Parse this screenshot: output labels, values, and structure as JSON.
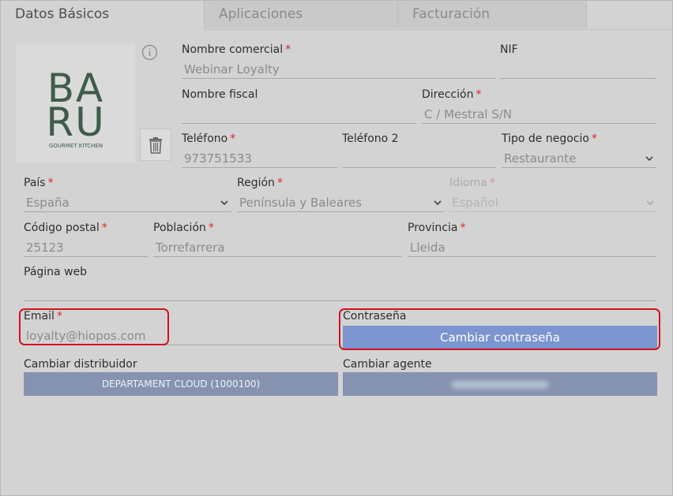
{
  "tabs": [
    {
      "label": "Datos Básicos"
    },
    {
      "label": "Aplicaciones"
    },
    {
      "label": "Facturación"
    }
  ],
  "logo": {
    "letters_top": "BA",
    "letters_bottom": "RU",
    "tagline": "GOURMET KITCHEN"
  },
  "icons": {
    "info": "info-icon",
    "delete": "trash-icon",
    "dropdown": "chevron-down-icon"
  },
  "form": {
    "nombre_comercial": {
      "label": "Nombre comercial",
      "value": "Webinar Loyalty",
      "required": "*"
    },
    "nif": {
      "label": "NIF",
      "value": ""
    },
    "nombre_fiscal": {
      "label": "Nombre fiscal",
      "value": ""
    },
    "direccion": {
      "label": "Dirección",
      "value": "C / Mestral S/N",
      "required": "*"
    },
    "telefono": {
      "label": "Teléfono",
      "value": "973751533",
      "required": "*"
    },
    "telefono2": {
      "label": "Teléfono 2",
      "value": ""
    },
    "tipo_negocio": {
      "label": "Tipo de negocio",
      "value": "Restaurante",
      "required": "*"
    },
    "pais": {
      "label": "País",
      "value": "España",
      "required": "*"
    },
    "region": {
      "label": "Región",
      "value": "Península y Baleares",
      "required": "*"
    },
    "idioma": {
      "label": "Idioma",
      "value": "Español",
      "required": "*"
    },
    "codigo_postal": {
      "label": "Código postal",
      "value": "25123",
      "required": "*"
    },
    "poblacion": {
      "label": "Población",
      "value": "Torrefarrera",
      "required": "*"
    },
    "provincia": {
      "label": "Provincia",
      "value": "Lleida",
      "required": "*"
    },
    "pagina_web": {
      "label": "Página web",
      "value": ""
    },
    "email": {
      "label": "Email",
      "value": "loyalty@hiopos.com",
      "required": "*"
    },
    "contrasena": {
      "label": "Contraseña",
      "button": "Cambiar contraseña"
    },
    "distribuidor": {
      "label": "Cambiar distribuidor",
      "button": "DEPARTAMENT CLOUD (1000100)"
    },
    "agente": {
      "label": "Cambiar agente"
    }
  },
  "colors": {
    "accent": "#7c95d1",
    "required": "#d9262c",
    "highlight": "#d0141b",
    "logo": "#3f5b4a"
  }
}
